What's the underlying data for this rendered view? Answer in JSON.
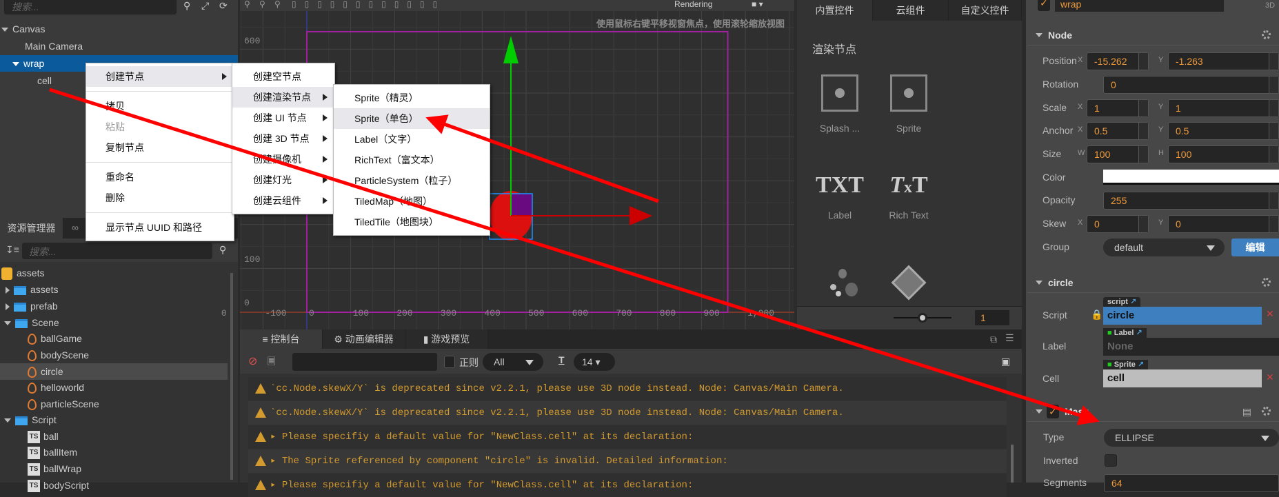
{
  "hierarchy": {
    "search_placeholder": "搜索...",
    "nodes": [
      "Canvas",
      "Main Camera",
      "wrap",
      "cell"
    ]
  },
  "context_menu": {
    "main": [
      "创建节点",
      "拷贝",
      "粘贴",
      "复制节点",
      "重命名",
      "删除",
      "显示节点 UUID 和路径"
    ],
    "create_node": [
      "创建空节点",
      "创建渲染节点",
      "创建 UI 节点",
      "创建 3D 节点",
      "创建摄像机",
      "创建灯光",
      "创建云组件"
    ],
    "render_node": [
      "Sprite（精灵）",
      "Sprite（单色）",
      "Label（文字）",
      "RichText（富文本）",
      "ParticleSystem（粒子）",
      "TiledMap（地图）",
      "TiledTile（地图块）"
    ]
  },
  "assets": {
    "tabs": [
      "资源管理器"
    ],
    "search_placeholder": "搜索...",
    "items": [
      "assets",
      "assets",
      "prefab",
      "Scene",
      "ballGame",
      "bodyScene",
      "circle",
      "helloworld",
      "particleScene",
      "Script",
      "ball",
      "ballItem",
      "ballWrap",
      "bodyScript"
    ]
  },
  "scene": {
    "toolbar_dropdown": "Rendering",
    "hint": "使用鼠标右键平移视窗焦点，使用滚轮缩放视图",
    "y_ticks": [
      "600",
      "100",
      "0"
    ],
    "x_ticks": [
      "0",
      "-100",
      "0",
      "100",
      "200",
      "300",
      "400",
      "500",
      "600",
      "700",
      "800",
      "900",
      "1,000"
    ],
    "colors": {
      "design_rect": "#a020a0",
      "node_fill": "#dd1010",
      "selection": "#1e90ff",
      "y_axis": "#00cc00",
      "x_axis": "#cc0000"
    }
  },
  "widgets": {
    "tabs": [
      "内置控件",
      "云组件",
      "自定义控件"
    ],
    "section": "渲染节点",
    "items": [
      "Splash ...",
      "Sprite",
      "Label",
      "Rich Text"
    ],
    "zoom_value": "1"
  },
  "console": {
    "tabs": [
      "控制台",
      "动画编辑器",
      "游戏预览"
    ],
    "regex_label": "正则",
    "level": "All",
    "font_size": "14",
    "messages": [
      "`cc.Node.skewX/Y` is deprecated since v2.2.1, please use 3D node instead. Node: Canvas/Main Camera.",
      "`cc.Node.skewX/Y` is deprecated since v2.2.1, please use 3D node instead. Node: Canvas/Main Camera.",
      "Please specifiy a default value for \"NewClass.cell\" at its declaration:",
      "The Sprite referenced by component \"circle\" is invalid. Detailed information:",
      "Please specifiy a default value for \"NewClass.cell\" at its declaration:"
    ]
  },
  "inspector": {
    "node_name": "wrap",
    "mode": "3D",
    "node_section": "Node",
    "position": {
      "label": "Position",
      "x": "-15.262",
      "y": "-1.263"
    },
    "rotation": {
      "label": "Rotation",
      "value": "0"
    },
    "scale": {
      "label": "Scale",
      "x": "1",
      "y": "1"
    },
    "anchor": {
      "label": "Anchor",
      "x": "0.5",
      "y": "0.5"
    },
    "size": {
      "label": "Size",
      "w": "100",
      "h": "100"
    },
    "color": {
      "label": "Color",
      "value": "#ffffff"
    },
    "opacity": {
      "label": "Opacity",
      "value": "255"
    },
    "skew": {
      "label": "Skew",
      "x": "0",
      "y": "0"
    },
    "group": {
      "label": "Group",
      "value": "default",
      "edit": "编辑"
    },
    "axis": {
      "x": "X",
      "y": "Y",
      "w": "W",
      "h": "H"
    },
    "circle_section": "circle",
    "script": {
      "label": "Script",
      "tag": "script",
      "value": "circle"
    },
    "label_prop": {
      "label": "Label",
      "tag": "Label",
      "value": "None"
    },
    "cell": {
      "label": "Cell",
      "tag": "Sprite",
      "value": "cell"
    },
    "mask_section": "Mask",
    "type": {
      "label": "Type",
      "value": "ELLIPSE"
    },
    "inverted": {
      "label": "Inverted",
      "checked": false
    },
    "segments": {
      "label": "Segments",
      "value": "64"
    }
  }
}
